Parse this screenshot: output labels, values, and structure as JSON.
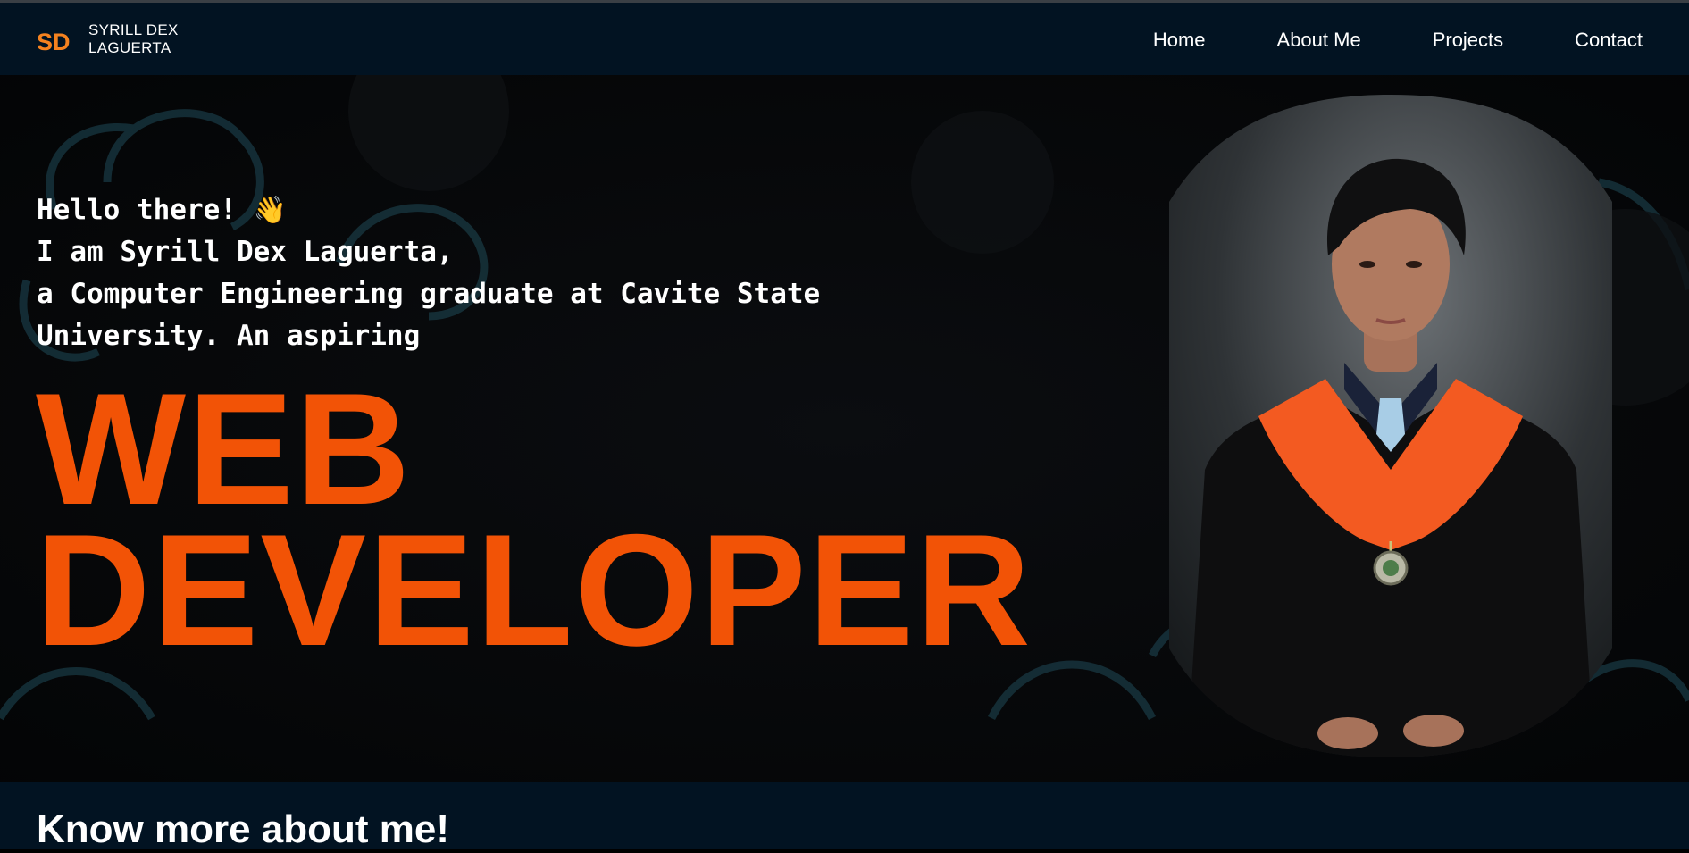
{
  "header": {
    "logo_initials": "SD",
    "brand_line1": "SYRILL DEX",
    "brand_line2": "LAGUERTA",
    "nav": [
      {
        "label": "Home"
      },
      {
        "label": "About Me"
      },
      {
        "label": "Projects"
      },
      {
        "label": "Contact"
      }
    ]
  },
  "hero": {
    "greeting_line1": "Hello there!",
    "wave_emoji": "👋",
    "greeting_line2": "I am Syrill Dex Laguerta,",
    "greeting_line3": "a Computer Engineering graduate at Cavite State University. An aspiring",
    "title_line1": "WEB",
    "title_line2": "DEVELOPER",
    "portrait_icon": "graduate-portrait"
  },
  "about": {
    "heading": "Know more about me!"
  },
  "colors": {
    "accent": "#f25306",
    "nav_bg": "#021322",
    "hero_bg": "#050608",
    "text": "#ffffff"
  }
}
